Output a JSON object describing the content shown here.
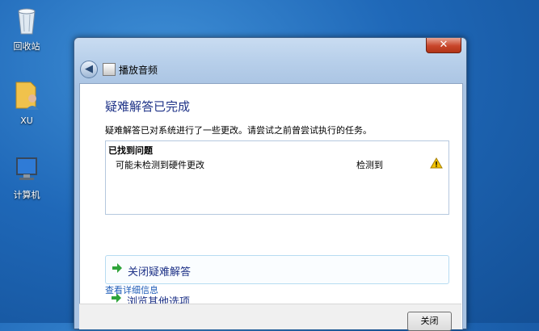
{
  "desktop": {
    "icons": [
      {
        "label": "回收站",
        "icon": "recycle-bin-icon"
      },
      {
        "label": "XU",
        "icon": "user-folder-icon"
      },
      {
        "label": "计算机",
        "icon": "computer-icon"
      }
    ]
  },
  "window": {
    "title": "播放音频",
    "close_glyph": "✕",
    "heading": "疑难解答已完成",
    "description": "疑难解答已对系统进行了一些更改。请尝试之前曾尝试执行的任务。",
    "problems": {
      "heading": "已找到问题",
      "items": [
        {
          "name": "可能未检测到硬件更改",
          "status": "检测到",
          "icon": "warning-icon"
        }
      ]
    },
    "options": [
      {
        "label": "关闭疑难解答",
        "icon": "green-arrow-icon"
      },
      {
        "label": "浏览其他选项",
        "icon": "green-arrow-icon"
      }
    ],
    "details_link": "查看详细信息",
    "footer": {
      "close_button": "关闭"
    }
  },
  "colors": {
    "heading": "#1e3287",
    "link": "#1f5db8",
    "arrow": "#2ea43a",
    "warning": "#f2c200"
  }
}
